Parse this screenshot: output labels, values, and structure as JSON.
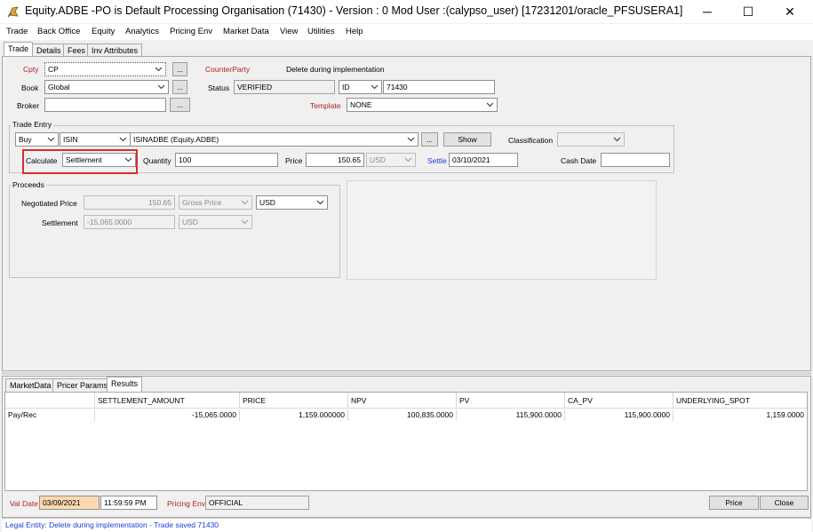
{
  "window": {
    "title": "Equity.ADBE  -PO is Default Processing Organisation  (71430) - Version : 0 Mod User :(calypso_user)  [17231201/oracle_PFSUSERA1]",
    "minimize": "─",
    "maximize": "☐",
    "close": "✕"
  },
  "menu": [
    "Trade",
    "Back Office",
    "Equity",
    "Analytics",
    "Pricing Env",
    "Market Data",
    "View",
    "Utilities",
    "Help"
  ],
  "tabs": [
    "Trade",
    "Details",
    "Fees",
    "Inv Attributes"
  ],
  "header": {
    "cpty_label": "Cpty",
    "cpty_value": "CP",
    "book_label": "Book",
    "book_value": "Global",
    "broker_label": "Broker",
    "broker_value": "",
    "ellipsis": "...",
    "counterparty_label": "CounterParty",
    "counterparty_value": "Delete during implementation",
    "status_label": "Status",
    "status_value": "VERIFIED",
    "id_type": "ID",
    "id_value": "71430",
    "template_label": "Template",
    "template_value": "NONE"
  },
  "trade_entry": {
    "legend": "Trade Entry",
    "direction": "Buy",
    "code_type": "ISIN",
    "product": "ISINADBE (Equity.ADBE)",
    "ellipsis": "...",
    "show_button": "Show",
    "classification_label": "Classification",
    "classification_value": "",
    "calculate_label": "Calculate",
    "calculate_value": "Settlement",
    "quantity_label": "Quantity",
    "quantity_value": "100",
    "price_label": "Price",
    "price_value": "150.65",
    "price_ccy": "USD",
    "settle_label": "Settle",
    "settle_value": "03/10/2021",
    "cash_date_label": "Cash Date",
    "cash_date_value": ""
  },
  "proceeds": {
    "legend": "Proceeds",
    "negotiated_price_label": "Negotiated Price",
    "negotiated_price_value": "150.65",
    "price_type": "Gross Price",
    "negotiated_ccy": "USD",
    "settlement_label": "Settlement",
    "settlement_value": "-15,065.0000",
    "settlement_ccy": "USD"
  },
  "bottom_tabs": [
    "MarketData",
    "Pricer Params",
    "Results"
  ],
  "results": {
    "columns": [
      "",
      "SETTLEMENT_AMOUNT",
      "PRICE",
      "NPV",
      "PV",
      "CA_PV",
      "UNDERLYING_SPOT"
    ],
    "rows": [
      [
        "Pay/Rec",
        "-15,065.0000",
        "1,159.000000",
        "100,835.0000",
        "115,900.0000",
        "115,900.0000",
        "1,159.0000"
      ]
    ]
  },
  "footer": {
    "val_date_label": "Val Date",
    "val_date": "03/09/2021",
    "val_time": "11:59:59 PM",
    "pricing_env_label": "Pricing Env",
    "pricing_env_value": "OFFICIAL",
    "price_button": "Price",
    "close_button": "Close"
  },
  "status_bar": "Legal Entity: Delete during implementation - Trade saved 71430",
  "colors": {
    "label_red": "#b22222",
    "label_blue": "#1b3fd6",
    "highlight_box": "#d32f2f",
    "val_date_bg": "#fcd9b0"
  }
}
